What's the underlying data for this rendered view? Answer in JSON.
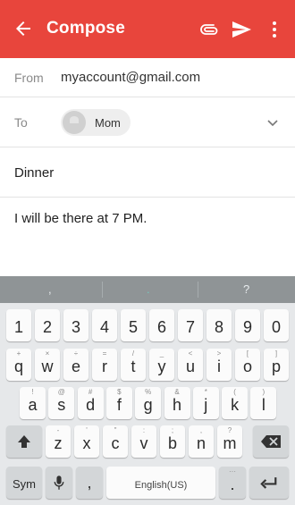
{
  "appbar": {
    "title": "Compose",
    "color": "#e8453c",
    "icons": [
      "back-arrow-icon",
      "paperclip-icon",
      "send-icon",
      "more-vert-icon"
    ]
  },
  "compose": {
    "from_label": "From",
    "from_value": "myaccount@gmail.com",
    "to_label": "To",
    "recipient_name": "Mom",
    "subject": "Dinner",
    "body": "I will be there at 7 PM."
  },
  "keyboard": {
    "suggestions": [
      ",",
      ".",
      "?"
    ],
    "row1": [
      {
        "k": "1",
        "h": ""
      },
      {
        "k": "2",
        "h": ""
      },
      {
        "k": "3",
        "h": ""
      },
      {
        "k": "4",
        "h": ""
      },
      {
        "k": "5",
        "h": ""
      },
      {
        "k": "6",
        "h": ""
      },
      {
        "k": "7",
        "h": ""
      },
      {
        "k": "8",
        "h": ""
      },
      {
        "k": "9",
        "h": ""
      },
      {
        "k": "0",
        "h": ""
      }
    ],
    "row2": [
      {
        "k": "q",
        "h": "+"
      },
      {
        "k": "w",
        "h": "×"
      },
      {
        "k": "e",
        "h": "÷"
      },
      {
        "k": "r",
        "h": "="
      },
      {
        "k": "t",
        "h": "/"
      },
      {
        "k": "y",
        "h": "_"
      },
      {
        "k": "u",
        "h": "<"
      },
      {
        "k": "i",
        "h": ">"
      },
      {
        "k": "o",
        "h": "["
      },
      {
        "k": "p",
        "h": "]"
      }
    ],
    "row3": [
      {
        "k": "a",
        "h": "!"
      },
      {
        "k": "s",
        "h": "@"
      },
      {
        "k": "d",
        "h": "#"
      },
      {
        "k": "f",
        "h": "$"
      },
      {
        "k": "g",
        "h": "%"
      },
      {
        "k": "h",
        "h": "&"
      },
      {
        "k": "j",
        "h": "*"
      },
      {
        "k": "k",
        "h": "("
      },
      {
        "k": "l",
        "h": ")"
      }
    ],
    "row4": [
      {
        "k": "z",
        "h": "-"
      },
      {
        "k": "x",
        "h": "'"
      },
      {
        "k": "c",
        "h": "\""
      },
      {
        "k": "v",
        "h": ":"
      },
      {
        "k": "b",
        "h": ";"
      },
      {
        "k": "n",
        "h": ","
      },
      {
        "k": "m",
        "h": "?"
      }
    ],
    "sym_label": "Sym",
    "comma": ",",
    "space_label": "English(US)",
    "period": ".",
    "period_hint": "···"
  }
}
